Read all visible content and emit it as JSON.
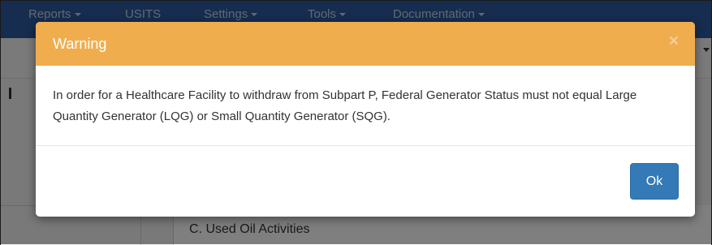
{
  "navbar": {
    "items": [
      {
        "label": "Reports",
        "has_caret": true
      },
      {
        "label": "USITS",
        "has_caret": false
      },
      {
        "label": "Settings",
        "has_caret": true
      },
      {
        "label": "Tools",
        "has_caret": true
      },
      {
        "label": "Documentation",
        "has_caret": true
      }
    ]
  },
  "background": {
    "row_label": "C. Used Oil Activities"
  },
  "modal": {
    "title": "Warning",
    "close_glyph": "×",
    "message": "In order for a Healthcare Facility to withdraw from Subpart P, Federal Generator Status must not equal Large Quantity Generator (LQG) or Small Quantity Generator (SQG).",
    "ok_label": "Ok"
  },
  "colors": {
    "navbar": "#2c5aa0",
    "modal_header": "#f0ad4e",
    "ok_button": "#337ab7"
  }
}
